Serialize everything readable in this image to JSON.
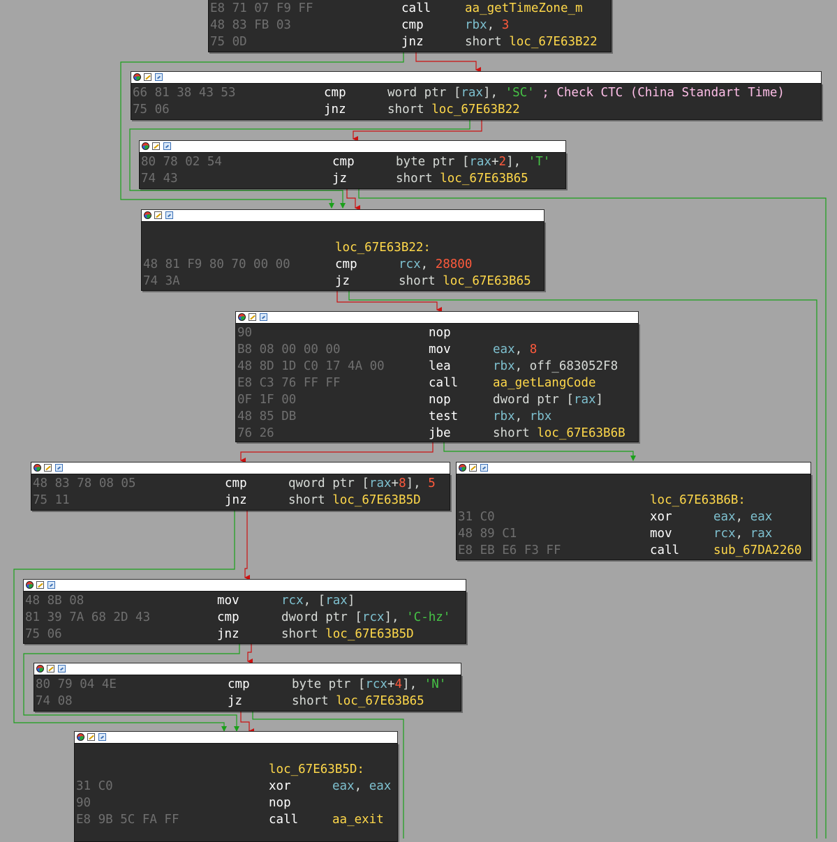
{
  "colors": {
    "background": "#a5a5a5",
    "node_body": "#2b2b2b",
    "edge_true": "#1aa01a",
    "edge_false": "#cc1111",
    "edge_unconditional": "#3d6bd6",
    "label": "#ffd84a",
    "register": "#7ec0cf",
    "number": "#ff5a3c",
    "string": "#46c346",
    "comment": "#ffbfe8"
  },
  "icons": [
    "graph-node-icon",
    "edit-icon",
    "xref-icon"
  ],
  "nodes": {
    "n0": {
      "lines": [
        {
          "bytes": "E8 71 07 F9 FF",
          "mnem": "call",
          "ops": [
            {
              "t": "aa_getTimeZone_m",
              "c": "sym"
            }
          ]
        },
        {
          "bytes": "48 83 FB 03",
          "mnem": "cmp",
          "ops": [
            {
              "t": "rbx",
              "c": "reg"
            },
            {
              "t": ", ",
              "c": "r"
            },
            {
              "t": "3",
              "c": "num"
            }
          ]
        },
        {
          "bytes": "75 0D",
          "mnem": "jnz",
          "ops": [
            {
              "t": "short ",
              "c": "r"
            },
            {
              "t": "loc_67E63B22",
              "c": "sym"
            }
          ]
        }
      ]
    },
    "n1": {
      "lines": [
        {
          "bytes": "66 81 38 43 53",
          "mnem": "cmp",
          "ops": [
            {
              "t": "word ptr [",
              "c": "r"
            },
            {
              "t": "rax",
              "c": "reg"
            },
            {
              "t": "], ",
              "c": "r"
            },
            {
              "t": "'SC'",
              "c": "str"
            },
            {
              "t": " ; Check CTC (China Standart Time)",
              "c": "cmt"
            }
          ]
        },
        {
          "bytes": "75 06",
          "mnem": "jnz",
          "ops": [
            {
              "t": "short ",
              "c": "r"
            },
            {
              "t": "loc_67E63B22",
              "c": "sym"
            }
          ]
        }
      ]
    },
    "n2": {
      "lines": [
        {
          "bytes": "80 78 02 54",
          "mnem": "cmp",
          "ops": [
            {
              "t": "byte ptr [",
              "c": "r"
            },
            {
              "t": "rax",
              "c": "reg"
            },
            {
              "t": "+",
              "c": "r"
            },
            {
              "t": "2",
              "c": "num"
            },
            {
              "t": "], ",
              "c": "r"
            },
            {
              "t": "'T'",
              "c": "str"
            }
          ]
        },
        {
          "bytes": "74 43",
          "mnem": "jz",
          "ops": [
            {
              "t": "short ",
              "c": "r"
            },
            {
              "t": "loc_67E63B65",
              "c": "sym"
            }
          ]
        }
      ]
    },
    "n3": {
      "label": "loc_67E63B22:",
      "lines": [
        {
          "bytes": "48 81 F9 80 70 00 00",
          "mnem": "cmp",
          "ops": [
            {
              "t": "rcx",
              "c": "reg"
            },
            {
              "t": ", ",
              "c": "r"
            },
            {
              "t": "28800",
              "c": "num"
            }
          ]
        },
        {
          "bytes": "74 3A",
          "mnem": "jz",
          "ops": [
            {
              "t": "short ",
              "c": "r"
            },
            {
              "t": "loc_67E63B65",
              "c": "sym"
            }
          ]
        }
      ]
    },
    "n4": {
      "lines": [
        {
          "bytes": "90",
          "mnem": "nop",
          "ops": []
        },
        {
          "bytes": "B8 08 00 00 00",
          "mnem": "mov",
          "ops": [
            {
              "t": "eax",
              "c": "reg"
            },
            {
              "t": ", ",
              "c": "r"
            },
            {
              "t": "8",
              "c": "num"
            }
          ]
        },
        {
          "bytes": "48 8D 1D C0 17 4A 00",
          "mnem": "lea",
          "ops": [
            {
              "t": "rbx",
              "c": "reg"
            },
            {
              "t": ", off_683052F8",
              "c": "r"
            }
          ]
        },
        {
          "bytes": "E8 C3 76 FF FF",
          "mnem": "call",
          "ops": [
            {
              "t": "aa_getLangCode",
              "c": "sym"
            }
          ]
        },
        {
          "bytes": "0F 1F 00",
          "mnem": "nop",
          "ops": [
            {
              "t": "dword ptr [",
              "c": "r"
            },
            {
              "t": "rax",
              "c": "reg"
            },
            {
              "t": "]",
              "c": "r"
            }
          ]
        },
        {
          "bytes": "48 85 DB",
          "mnem": "test",
          "ops": [
            {
              "t": "rbx",
              "c": "reg"
            },
            {
              "t": ", ",
              "c": "r"
            },
            {
              "t": "rbx",
              "c": "reg"
            }
          ]
        },
        {
          "bytes": "76 26",
          "mnem": "jbe",
          "ops": [
            {
              "t": "short ",
              "c": "r"
            },
            {
              "t": "loc_67E63B6B",
              "c": "sym"
            }
          ]
        }
      ]
    },
    "n5": {
      "lines": [
        {
          "bytes": "48 83 78 08 05",
          "mnem": "cmp",
          "ops": [
            {
              "t": "qword ptr [",
              "c": "r"
            },
            {
              "t": "rax",
              "c": "reg"
            },
            {
              "t": "+",
              "c": "r"
            },
            {
              "t": "8",
              "c": "num"
            },
            {
              "t": "], ",
              "c": "r"
            },
            {
              "t": "5",
              "c": "num"
            }
          ]
        },
        {
          "bytes": "75 11",
          "mnem": "jnz",
          "ops": [
            {
              "t": "short ",
              "c": "r"
            },
            {
              "t": "loc_67E63B5D",
              "c": "sym"
            }
          ]
        }
      ]
    },
    "n6": {
      "label": "loc_67E63B6B:",
      "lines": [
        {
          "bytes": "31 C0",
          "mnem": "xor",
          "ops": [
            {
              "t": "eax",
              "c": "reg"
            },
            {
              "t": ", ",
              "c": "r"
            },
            {
              "t": "eax",
              "c": "reg"
            }
          ]
        },
        {
          "bytes": "48 89 C1",
          "mnem": "mov",
          "ops": [
            {
              "t": "rcx",
              "c": "reg"
            },
            {
              "t": ", ",
              "c": "r"
            },
            {
              "t": "rax",
              "c": "reg"
            }
          ]
        },
        {
          "bytes": "E8 EB E6 F3 FF",
          "mnem": "call",
          "ops": [
            {
              "t": "sub_67DA2260",
              "c": "sym"
            }
          ]
        }
      ]
    },
    "n7": {
      "lines": [
        {
          "bytes": "48 8B 08",
          "mnem": "mov",
          "ops": [
            {
              "t": "rcx",
              "c": "reg"
            },
            {
              "t": ", [",
              "c": "r"
            },
            {
              "t": "rax",
              "c": "reg"
            },
            {
              "t": "]",
              "c": "r"
            }
          ]
        },
        {
          "bytes": "81 39 7A 68 2D 43",
          "mnem": "cmp",
          "ops": [
            {
              "t": "dword ptr [",
              "c": "r"
            },
            {
              "t": "rcx",
              "c": "reg"
            },
            {
              "t": "], ",
              "c": "r"
            },
            {
              "t": "'C-hz'",
              "c": "str"
            }
          ]
        },
        {
          "bytes": "75 06",
          "mnem": "jnz",
          "ops": [
            {
              "t": "short ",
              "c": "r"
            },
            {
              "t": "loc_67E63B5D",
              "c": "sym"
            }
          ]
        }
      ]
    },
    "n8": {
      "lines": [
        {
          "bytes": "80 79 04 4E",
          "mnem": "cmp",
          "ops": [
            {
              "t": "byte ptr [",
              "c": "r"
            },
            {
              "t": "rcx",
              "c": "reg"
            },
            {
              "t": "+",
              "c": "r"
            },
            {
              "t": "4",
              "c": "num"
            },
            {
              "t": "], ",
              "c": "r"
            },
            {
              "t": "'N'",
              "c": "str"
            }
          ]
        },
        {
          "bytes": "74 08",
          "mnem": "jz",
          "ops": [
            {
              "t": "short ",
              "c": "r"
            },
            {
              "t": "loc_67E63B65",
              "c": "sym"
            }
          ]
        }
      ]
    },
    "n9": {
      "label": "loc_67E63B5D:",
      "lines": [
        {
          "bytes": "31 C0",
          "mnem": "xor",
          "ops": [
            {
              "t": "eax",
              "c": "reg"
            },
            {
              "t": ", ",
              "c": "r"
            },
            {
              "t": "eax",
              "c": "reg"
            }
          ]
        },
        {
          "bytes": "90",
          "mnem": "nop",
          "ops": []
        },
        {
          "bytes": "E8 9B 5C FA FF",
          "mnem": "call",
          "ops": [
            {
              "t": "aa_exit",
              "c": "sym"
            }
          ]
        }
      ]
    }
  }
}
